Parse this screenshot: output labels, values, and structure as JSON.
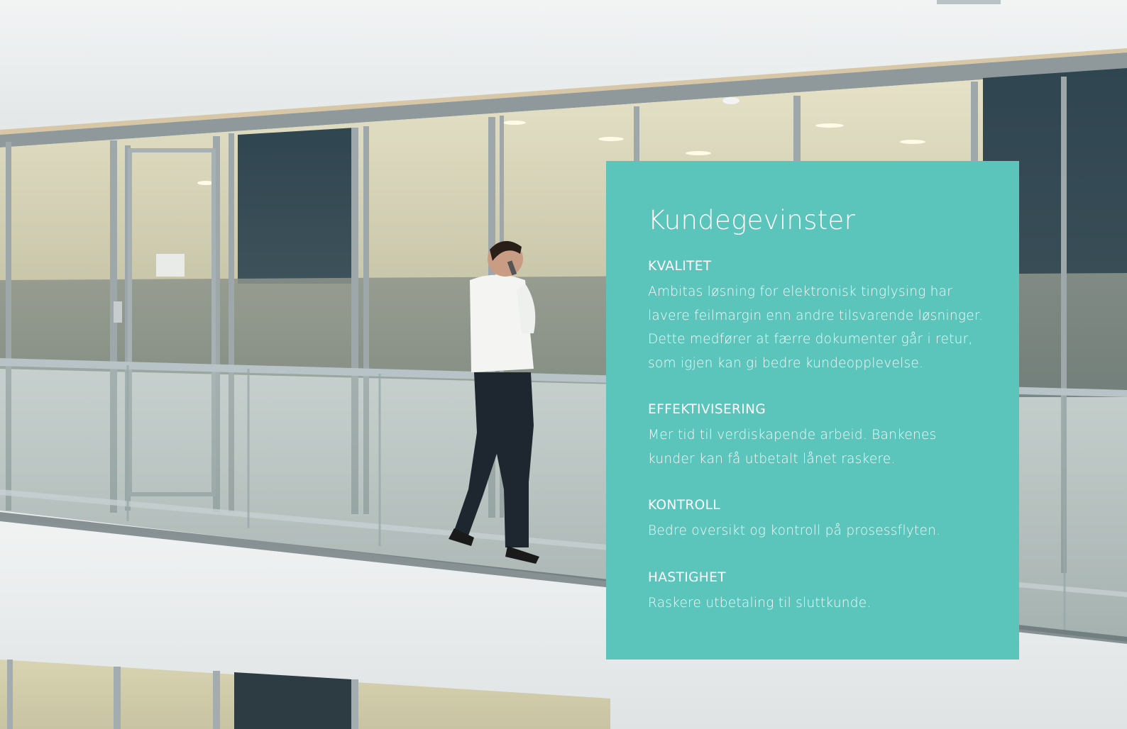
{
  "card": {
    "title": "Kundegevinster",
    "sections": [
      {
        "heading": "KVALITET",
        "lines": [
          "Ambitas løsning for elektronisk tinglysing har",
          "lavere feilmargin enn andre tilsvarende løsninger.",
          "Dette medfører at færre dokumenter går i retur,",
          "som igjen kan gi bedre kundeopplevelse."
        ]
      },
      {
        "heading": "EFFEKTIVISERING",
        "lines": [
          "Mer tid til verdiskapende arbeid. Bankenes",
          "kunder kan få utbetalt lånet raskere."
        ]
      },
      {
        "heading": "KONTROLL",
        "lines": [
          "Bedre oversikt og kontroll på prosessflyten."
        ]
      },
      {
        "heading": "HASTIGHET",
        "lines": [
          "Raskere utbetaling til sluttkunde."
        ]
      }
    ]
  },
  "colors": {
    "card_background": "#5bc4bb",
    "text": "#ffffff"
  }
}
